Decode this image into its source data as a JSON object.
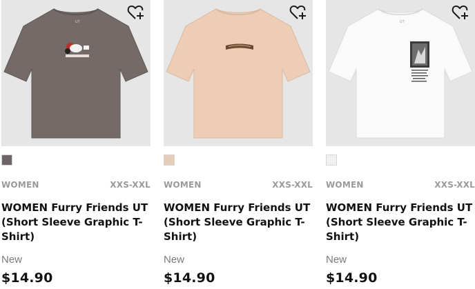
{
  "products": [
    {
      "gender": "WOMEN",
      "sizes": "XXS-XXL",
      "title": "WOMEN Furry Friends UT (Short Sleeve Graphic T-Shirt)",
      "flag": "New",
      "price": "$14.90",
      "shirt_color": "#746b69",
      "swatch_color": "#6f6566",
      "favorite_icon": "heart-plus-icon"
    },
    {
      "gender": "WOMEN",
      "sizes": "XXS-XXL",
      "title": "WOMEN Furry Friends UT (Short Sleeve Graphic T-Shirt)",
      "flag": "New",
      "price": "$14.90",
      "shirt_color": "#edcdb5",
      "swatch_color": "#e6cdb6",
      "favorite_icon": "heart-plus-icon"
    },
    {
      "gender": "WOMEN",
      "sizes": "XXS-XXL",
      "title": "WOMEN Furry Friends UT (Short Sleeve Graphic T-Shirt)",
      "flag": "New",
      "price": "$14.90",
      "shirt_color": "#fafafa",
      "swatch_color": "#f2f2f2",
      "favorite_icon": "heart-plus-icon"
    }
  ]
}
